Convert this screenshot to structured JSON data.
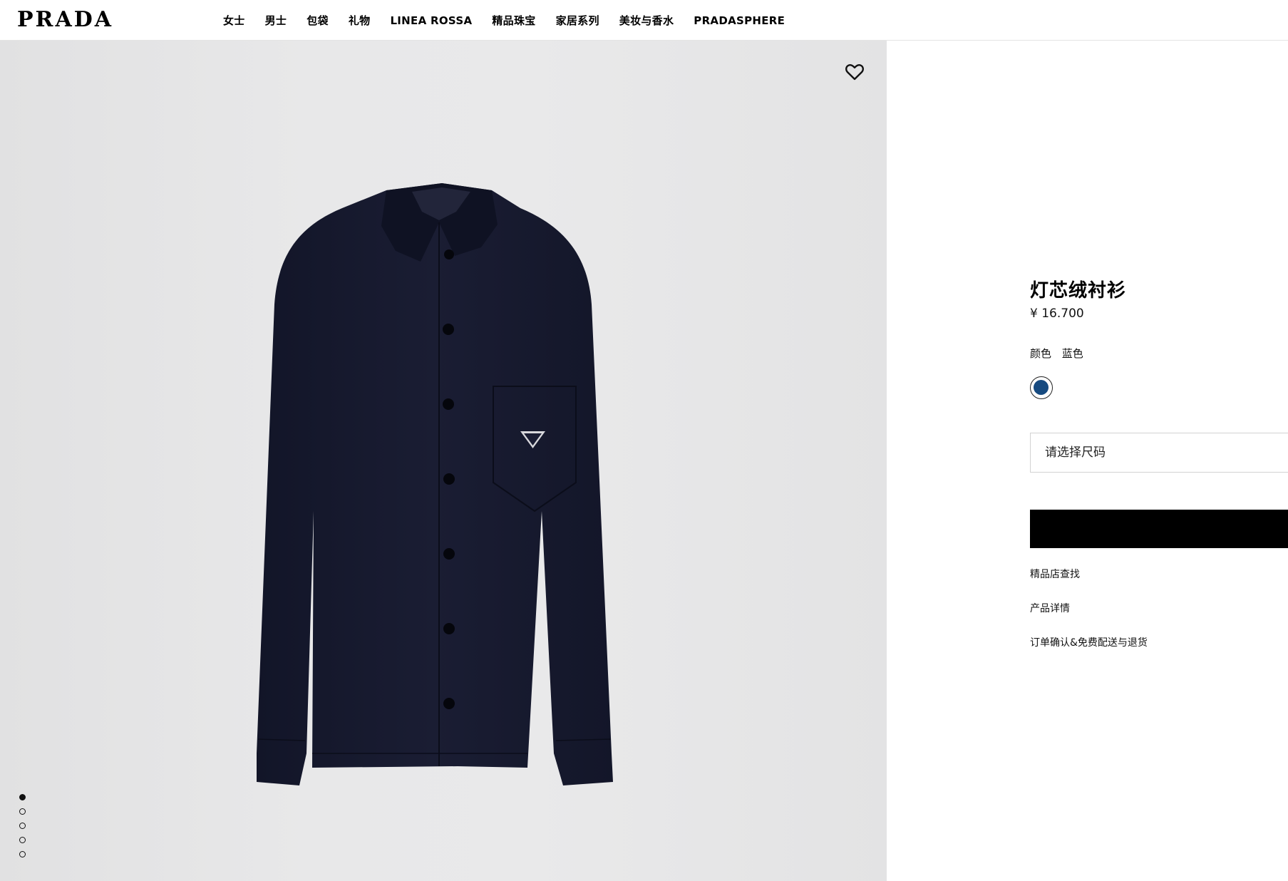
{
  "header": {
    "logo": "PRADA",
    "nav": [
      "女士",
      "男士",
      "包袋",
      "礼物",
      "LINEA ROSSA",
      "精品珠宝",
      "家居系列",
      "美妆与香水",
      "PRADASPHERE"
    ]
  },
  "gallery": {
    "wishlist_icon": "heart-outline-icon",
    "image_description_icon": "shirt-image",
    "slide_count": 5,
    "active_slide": 1
  },
  "product": {
    "title": "灯芯绒衬衫",
    "price": "¥ 16.700",
    "color_label": "颜色",
    "color_value": "蓝色",
    "swatch_color": "#164a80",
    "size_placeholder": "请选择尺码",
    "add_button_label": "",
    "links": [
      "精品店查找",
      "产品详情",
      "订单确认&免费配送与退货"
    ]
  },
  "colors": {
    "button_bg": "#000000",
    "gallery_bg": "#e8e8e9",
    "shirt": "#171a2e"
  }
}
